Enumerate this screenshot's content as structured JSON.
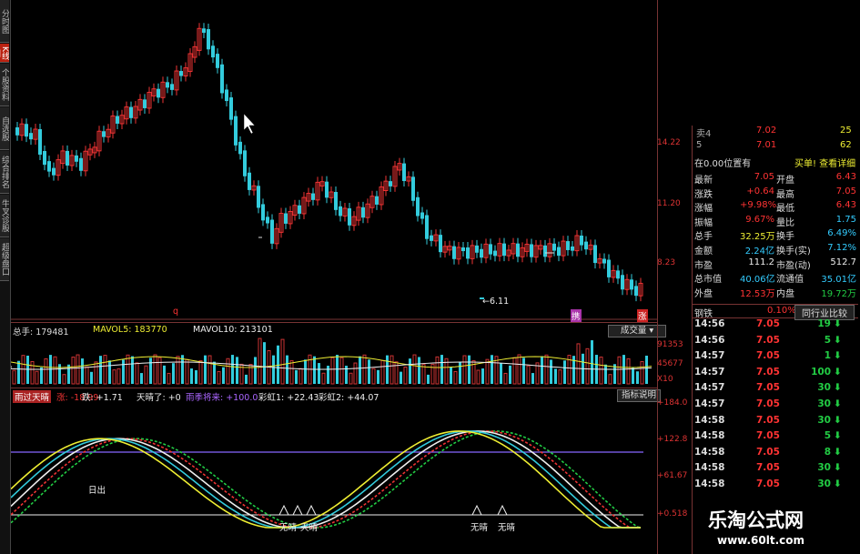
{
  "sidebar": {
    "tabs": [
      {
        "label": "分时图",
        "active": false
      },
      {
        "label": "K线图",
        "active": true
      },
      {
        "label": "个股资料",
        "active": false
      },
      {
        "label": "自选股",
        "active": false
      },
      {
        "label": "综合排名",
        "active": false
      },
      {
        "label": "牛叉诊股",
        "active": false
      },
      {
        "label": "超级盘口",
        "active": false
      }
    ]
  },
  "main_chart": {
    "price_axis": [
      "14.22",
      "11.20",
      "8.23"
    ],
    "low_marker": "6.11",
    "marker_q": "q",
    "marker_jin": "携",
    "marker_zhang": "涨"
  },
  "volume": {
    "label_total": "总手: 179481",
    "label_mavol5": "MAVOL5: 183770",
    "label_mavol10": "MAVOL10: 213101",
    "dropdown": "成交量",
    "axis": [
      "91353",
      "45677",
      "X10"
    ]
  },
  "indicator": {
    "name": "雨过天晴",
    "items": [
      {
        "text": "涨: -18.99",
        "color": "#ee3333"
      },
      {
        "text": "跌: +1.71",
        "color": "#eeeeee"
      },
      {
        "text": "天晴了: +0",
        "color": "#eeeeee"
      },
      {
        "text": "雨季将来: +100.0",
        "color": "#aa66ff"
      },
      {
        "text": "彩虹1: +22.43",
        "color": "#eeeeee"
      },
      {
        "text": "彩虹2: +44.07",
        "color": "#eeeeee"
      }
    ],
    "help_button": "指标说明",
    "axis": [
      "+184.0",
      "+122.8",
      "+61.67",
      "+0.518"
    ],
    "annotations": [
      "日出",
      "无晴",
      "天晴",
      "无晴",
      "无晴"
    ]
  },
  "quote_panel": {
    "ask_rows": [
      {
        "label": "卖4",
        "price": "7.02",
        "vol": "25"
      },
      {
        "label": "5",
        "price": "7.01",
        "vol": "62"
      }
    ],
    "status_left": "在0.00位置有",
    "status_right": "买单! 查看详细",
    "rows": [
      {
        "l1": "最新",
        "v1": "7.05",
        "c1": "#f33",
        "l2": "开盘",
        "v2": "6.43",
        "c2": "#f33"
      },
      {
        "l1": "涨跌",
        "v1": "+0.64",
        "c1": "#f33",
        "l2": "最高",
        "v2": "7.05",
        "c2": "#f33"
      },
      {
        "l1": "涨幅",
        "v1": "+9.98%",
        "c1": "#f33",
        "l2": "最低",
        "v2": "6.43",
        "c2": "#f33"
      },
      {
        "l1": "振幅",
        "v1": "9.67%",
        "c1": "#f33",
        "l2": "量比",
        "v2": "1.75",
        "c2": "#3cf"
      },
      {
        "l1": "总手",
        "v1": "32.25万",
        "c1": "#ee3",
        "l2": "换手",
        "v2": "6.49%",
        "c2": "#3cf"
      },
      {
        "l1": "金额",
        "v1": "2.24亿",
        "c1": "#3cf",
        "l2": "换手(实)",
        "v2": "7.12%",
        "c2": "#3cf"
      },
      {
        "l1": "市盈",
        "v1": "111.2",
        "c1": "#eee",
        "l2": "市盈(动)",
        "v2": "512.7",
        "c2": "#eee"
      },
      {
        "l1": "总市值",
        "v1": "40.06亿",
        "c1": "#3cf",
        "l2": "流通值",
        "v2": "35.01亿",
        "c2": "#3cf"
      },
      {
        "l1": "外盘",
        "v1": "12.53万",
        "c1": "#f33",
        "l2": "内盘",
        "v2": "19.72万",
        "c2": "#2c4"
      }
    ],
    "industry_label": "钢铁",
    "industry_pct": "0.10%",
    "compare_button": "同行业比较",
    "trades": [
      {
        "time": "14:56",
        "price": "7.05",
        "vol": "19"
      },
      {
        "time": "14:56",
        "price": "7.05",
        "vol": "5"
      },
      {
        "time": "14:57",
        "price": "7.05",
        "vol": "1"
      },
      {
        "time": "14:57",
        "price": "7.05",
        "vol": "100"
      },
      {
        "time": "14:57",
        "price": "7.05",
        "vol": "30"
      },
      {
        "time": "14:57",
        "price": "7.05",
        "vol": "30"
      },
      {
        "time": "14:58",
        "price": "7.05",
        "vol": "30"
      },
      {
        "time": "14:58",
        "price": "7.05",
        "vol": "5"
      },
      {
        "time": "14:58",
        "price": "7.05",
        "vol": "8"
      },
      {
        "time": "14:58",
        "price": "7.05",
        "vol": "30"
      },
      {
        "time": "14:58",
        "price": "7.05",
        "vol": "30"
      }
    ]
  },
  "watermark": {
    "title": "乐淘公式网",
    "url": "www.60lt.com"
  }
}
